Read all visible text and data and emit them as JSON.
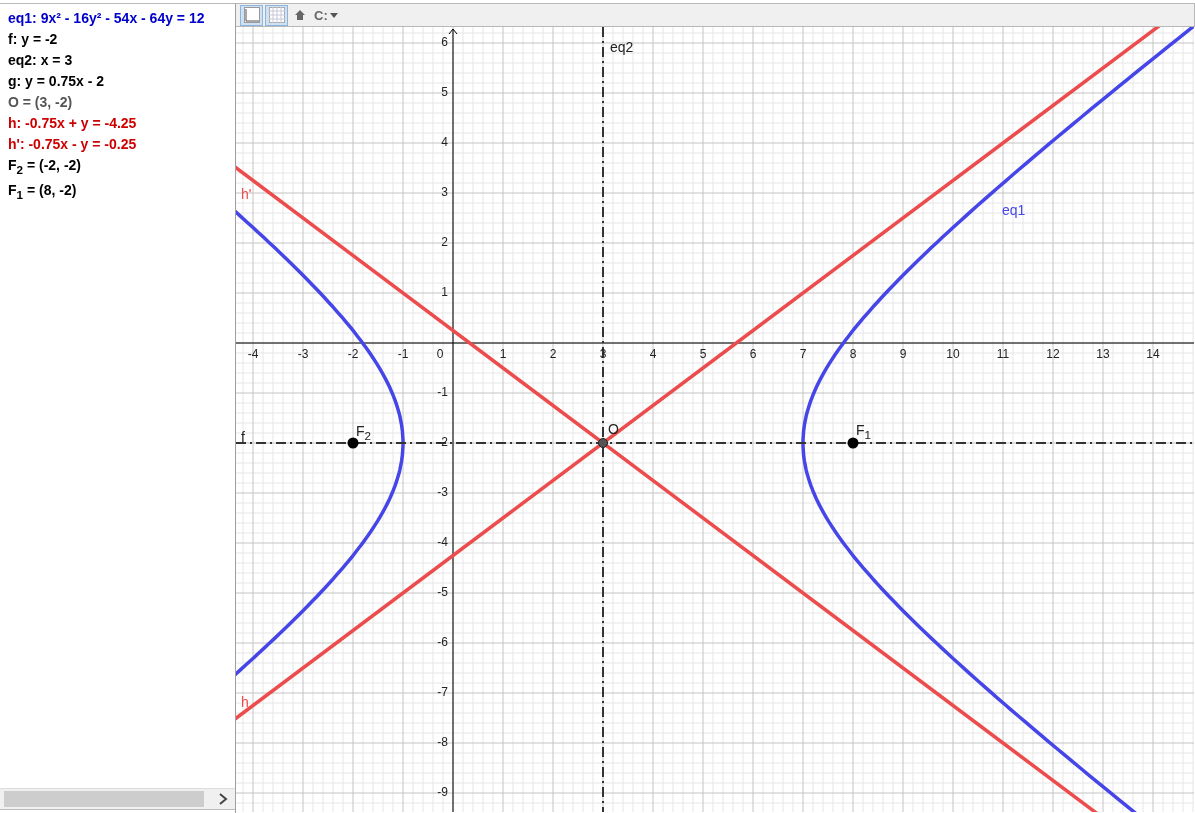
{
  "algebra_view": {
    "items": [
      {
        "text": "eq1: 9x² - 16y² - 54x - 64y = 12",
        "color": "#0000cc"
      },
      {
        "text": "f: y = -2",
        "color": "#000000"
      },
      {
        "text": "eq2: x = 3",
        "color": "#000000"
      },
      {
        "text": "g: y = 0.75x - 2",
        "color": "#000000"
      },
      {
        "text": "O = (3, -2)",
        "color": "#555555"
      },
      {
        "text": "h: -0.75x + y = -4.25",
        "color": "#cc0000"
      },
      {
        "text": "h': -0.75x - y = -0.25",
        "color": "#cc0000"
      },
      {
        "text": "F$_{2}$ = (-2, -2)",
        "color": "#000000"
      },
      {
        "text": "F$_{1}$ = (8, -2)",
        "color": "#000000"
      }
    ]
  },
  "toolbar": {
    "buttons": [
      {
        "kind": "axes",
        "on": true
      },
      {
        "kind": "grid",
        "on": true
      },
      {
        "kind": "home"
      },
      {
        "kind": "point_capture",
        "label": "C:"
      }
    ]
  },
  "graphics_view": {
    "x_tick_labels": [
      "-4",
      "-3",
      "-2",
      "-1",
      "0",
      "1",
      "2",
      "3",
      "4",
      "5",
      "6",
      "7",
      "8",
      "9",
      "10",
      "11",
      "12",
      "13",
      "14"
    ],
    "y_tick_labels": [
      "6",
      "5",
      "4",
      "3",
      "2",
      "1",
      "-1",
      "-2",
      "-3",
      "-4",
      "-5",
      "-6",
      "-7",
      "-8",
      "-9"
    ],
    "objects": [
      {
        "kind": "vertical_line",
        "label": "eq2"
      },
      {
        "kind": "line",
        "label": "h'",
        "color": "#ec4c4c"
      },
      {
        "kind": "conic",
        "label": "eq1",
        "color": "#4545e8"
      },
      {
        "kind": "horizontal_line",
        "label": "f"
      },
      {
        "kind": "point",
        "label": "F$_{2}$",
        "color": "#000000"
      },
      {
        "kind": "point",
        "label": "O",
        "color": "#555555"
      },
      {
        "kind": "point",
        "label": "F$_{1}$",
        "color": "#000000"
      },
      {
        "kind": "line",
        "label": "h",
        "color": "#ec4c4c"
      }
    ]
  }
}
